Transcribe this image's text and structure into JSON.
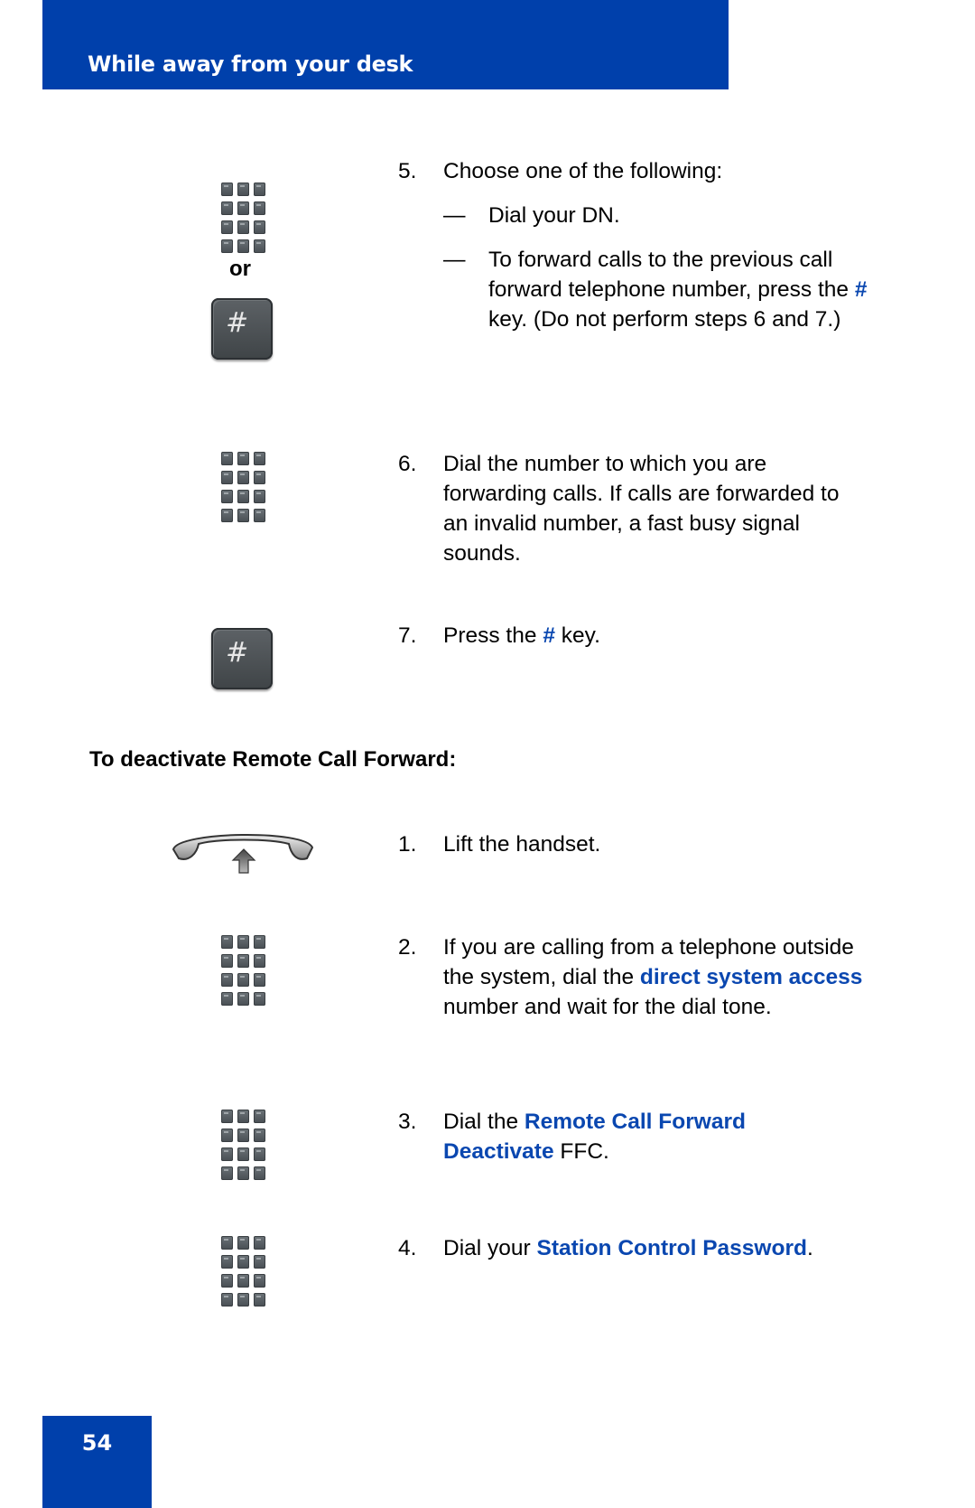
{
  "header": {
    "title": "While away from your desk"
  },
  "footer": {
    "page_number": "54"
  },
  "icons": {
    "or_label": "or",
    "hash_glyph": "#"
  },
  "activate_steps": {
    "step5": {
      "num": "5.",
      "text": "Choose one of the following:",
      "options": [
        {
          "dash": "—",
          "text": "Dial your DN."
        },
        {
          "dash": "—",
          "pre": "To forward calls to the previous call forward telephone number, press the ",
          "hl": "#",
          "post": " key. (Do not perform steps 6 and 7.)"
        }
      ]
    },
    "step6": {
      "num": "6.",
      "text": "Dial the number to which you are forwarding calls. If calls are forwarded to an invalid number, a fast busy signal sounds."
    },
    "step7": {
      "num": "7.",
      "pre": "Press the ",
      "hl": "#",
      "post": " key."
    }
  },
  "deactivate": {
    "heading": "To deactivate Remote Call Forward:",
    "steps": [
      {
        "num": "1.",
        "text": "Lift the handset."
      },
      {
        "num": "2.",
        "pre": "If you are calling from a telephone outside the system, dial the ",
        "hl": "direct system access",
        "post": " number and wait for the dial tone."
      },
      {
        "num": "3.",
        "pre": "Dial the ",
        "hl": "Remote Call Forward Deactivate",
        "post": " FFC."
      },
      {
        "num": "4.",
        "pre": "Dial your ",
        "hl": "Station Control Password",
        "post": "."
      }
    ]
  },
  "colors": {
    "brand_blue": "#0040ab",
    "link_blue": "#0a47b0"
  }
}
